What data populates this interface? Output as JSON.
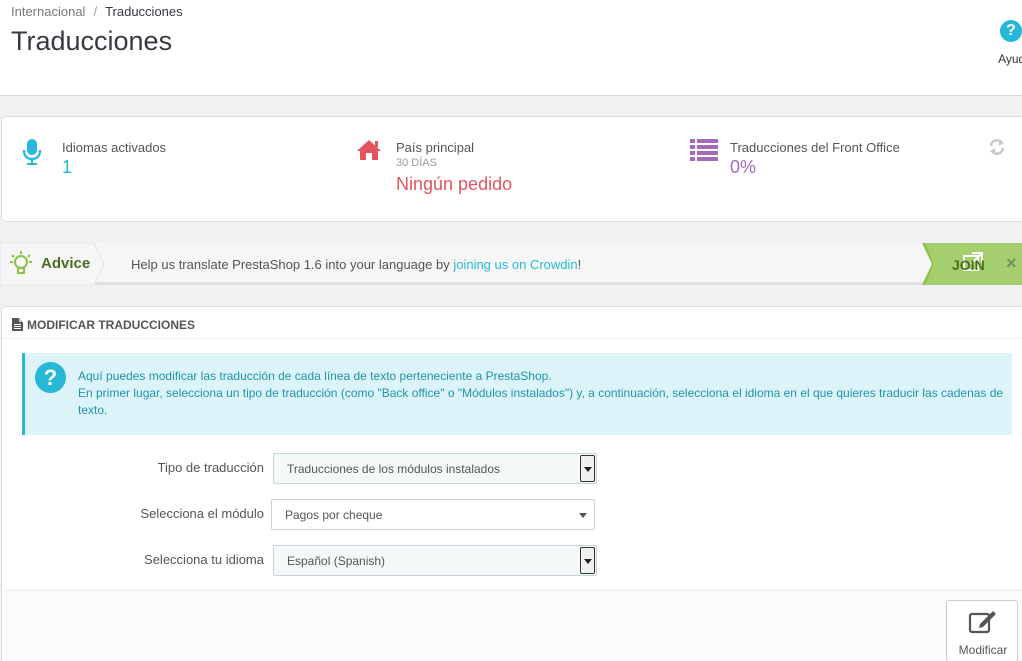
{
  "breadcrumb": {
    "parent": "Internacional",
    "separator": "/",
    "current": "Traducciones"
  },
  "header": {
    "title": "Traducciones",
    "help_label": "Ayuda",
    "help_glyph": "?"
  },
  "kpis": [
    {
      "title": "Idiomas activados",
      "sub": "",
      "value": "1",
      "color": "#25b9d7",
      "icon": "microphone-icon"
    },
    {
      "title": "País principal",
      "sub": "30 DÍAS",
      "value": "Ningún pedido",
      "color": "#e3545e",
      "icon": "home-icon"
    },
    {
      "title": "Traducciones del Front Office",
      "sub": "",
      "value": "0%",
      "color": "#a569bd",
      "icon": "list-icon"
    }
  ],
  "advice": {
    "label": "Advice",
    "message_before": "Help us translate PrestaShop 1.6 into your language by ",
    "link_text": "joining us on Crowdin",
    "message_after": "!",
    "join_label": "JOIN",
    "close_glyph": "×"
  },
  "panel": {
    "heading": "MODIFICAR TRADUCCIONES",
    "alert_line1": "Aquí puedes modificar las traducción de cada línea de texto perteneciente a PrestaShop.",
    "alert_line2": "En primer lugar, selecciona un tipo de traducción (como \"Back office\" o \"Módulos instalados\") y, a continuación, selecciona el idioma en el que quieres traducir las cadenas de texto.",
    "alert_glyph": "?"
  },
  "form": {
    "type_label": "Tipo de traducción",
    "type_value": "Traducciones de los módulos instalados",
    "module_label": "Selecciona el módulo",
    "module_value": "Pagos por cheque",
    "language_label": "Selecciona tu idioma",
    "language_value": "Español (Spanish)"
  },
  "actions": {
    "modify_label": "Modificar"
  },
  "colors": {
    "accent": "#25b9d7",
    "danger": "#e3545e",
    "purple": "#a569bd",
    "advice_green": "#8bc34a"
  }
}
